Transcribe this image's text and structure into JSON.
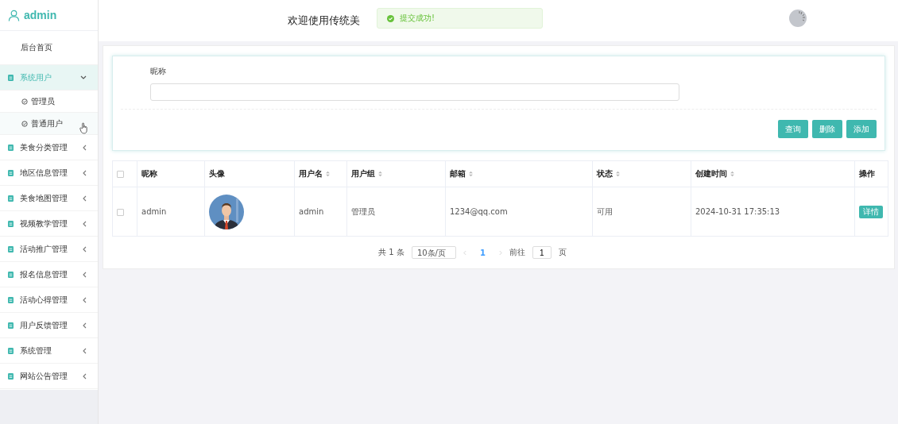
{
  "sidebar": {
    "user": "admin",
    "items": [
      {
        "label": "后台首页",
        "kind": "link",
        "selected": false
      },
      {
        "label": "系统用户",
        "kind": "group",
        "expanded": true,
        "selected": true,
        "children": [
          {
            "label": "管理员",
            "selected": false
          },
          {
            "label": "普通用户",
            "selected": true
          }
        ]
      },
      {
        "label": "美食分类管理",
        "kind": "group",
        "expanded": false,
        "selected": false
      },
      {
        "label": "地区信息管理",
        "kind": "group",
        "expanded": false,
        "selected": false
      },
      {
        "label": "美食地图管理",
        "kind": "group",
        "expanded": false,
        "selected": false
      },
      {
        "label": "视频教学管理",
        "kind": "group",
        "expanded": false,
        "selected": false
      },
      {
        "label": "活动推广管理",
        "kind": "group",
        "expanded": false,
        "selected": false
      },
      {
        "label": "报名信息管理",
        "kind": "group",
        "expanded": false,
        "selected": false
      },
      {
        "label": "活动心得管理",
        "kind": "group",
        "expanded": false,
        "selected": false
      },
      {
        "label": "用户反馈管理",
        "kind": "group",
        "expanded": false,
        "selected": false
      },
      {
        "label": "系统管理",
        "kind": "group",
        "expanded": false,
        "selected": false
      },
      {
        "label": "网站公告管理",
        "kind": "group",
        "expanded": false,
        "selected": false
      }
    ]
  },
  "header": {
    "title": "欢迎使用传统美"
  },
  "toast": {
    "message": "提交成功!"
  },
  "search": {
    "label": "昵称",
    "buttons": [
      "查询",
      "删除",
      "添加"
    ]
  },
  "table": {
    "select_all_checked": false,
    "columns": [
      {
        "label": "昵称",
        "sortable": false
      },
      {
        "label": "头像",
        "sortable": false
      },
      {
        "label": "用户名",
        "sortable": true
      },
      {
        "label": "用户组",
        "sortable": true
      },
      {
        "label": "邮箱",
        "sortable": true
      },
      {
        "label": "状态",
        "sortable": true
      },
      {
        "label": "创建时间",
        "sortable": true
      },
      {
        "label": "操作",
        "sortable": false
      }
    ],
    "rows": [
      {
        "checked": false,
        "nickname": "admin",
        "username": "admin",
        "group": "管理员",
        "email": "1234@qq.com",
        "status": "可用",
        "created": "2024-10-31 17:35:13",
        "action": "详情"
      }
    ]
  },
  "pagination": {
    "total": "共 1 条",
    "page_size": "10条/页",
    "pages": [
      {
        "label": "1",
        "selected": true
      }
    ],
    "goto_label": "前往",
    "goto_value": "1",
    "goto_suffix": "页"
  }
}
